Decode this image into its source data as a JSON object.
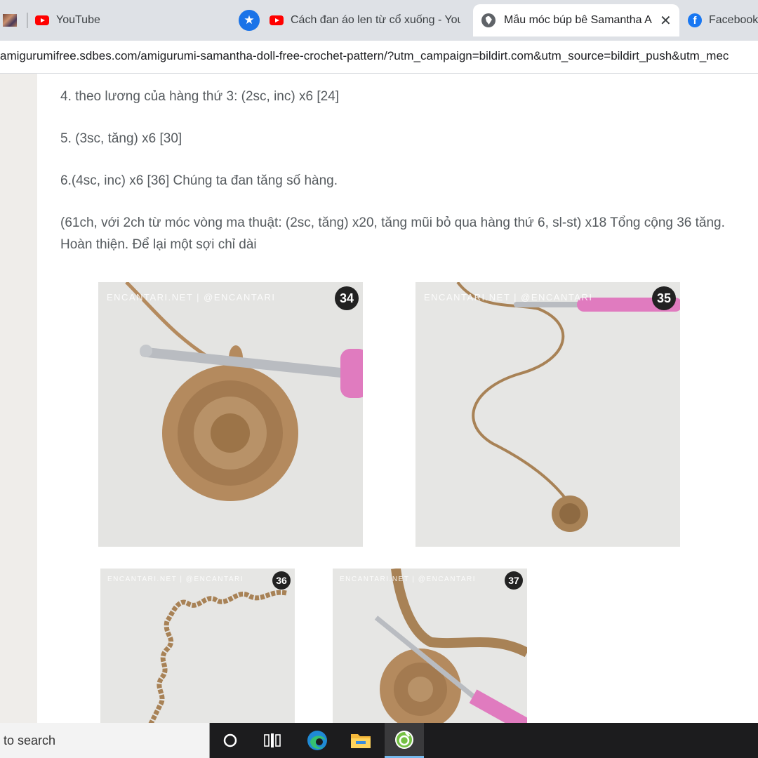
{
  "browser": {
    "tabs": [
      {
        "title": "YouTube"
      },
      {
        "title": "Cách đan áo len từ cổ xuống - You"
      },
      {
        "title": "Mẫu móc búp bê Samantha A",
        "active": true
      },
      {
        "title": "Facebook"
      }
    ],
    "url": "amigurumifree.sdbes.com/amigurumi-samantha-doll-free-crochet-pattern/?utm_campaign=bildirt.com&utm_source=bildirt_push&utm_mec"
  },
  "article": {
    "steps": [
      "4. theo lương của hàng thứ 3: (2sc, inc) x6 [24]",
      "5. (3sc, tăng) x6 [30]",
      "6.(4sc, inc) x6 [36] Chúng ta đan tăng số hàng.",
      "(61ch, với 2ch từ móc vòng ma thuật: (2sc, tăng) x20, tăng mũi bỏ qua hàng thứ 6, sl-st) x18 Tổng cộng 36 tăng. Hoàn thiện. Để lại một sợi chỉ dài"
    ],
    "photos": [
      {
        "watermark": "ENCANTARI.NET | @ENCANTARI",
        "number": "34"
      },
      {
        "watermark": "ENCANTARI.NET | @ENCANTARI",
        "number": "35"
      },
      {
        "watermark": "ENCANTARI.NET | @ENCANTARI",
        "number": "36"
      },
      {
        "watermark": "ENCANTARI.NET | @ENCANTARI",
        "number": "37"
      }
    ]
  },
  "taskbar": {
    "search_placeholder": "to search",
    "apps": [
      "task-view-icon",
      "edge-icon",
      "file-explorer-icon",
      "app-icon"
    ]
  },
  "colors": {
    "yarn": "#b48a5e",
    "hook_handle": "#e07bbf",
    "accent": "#1a73e8"
  }
}
